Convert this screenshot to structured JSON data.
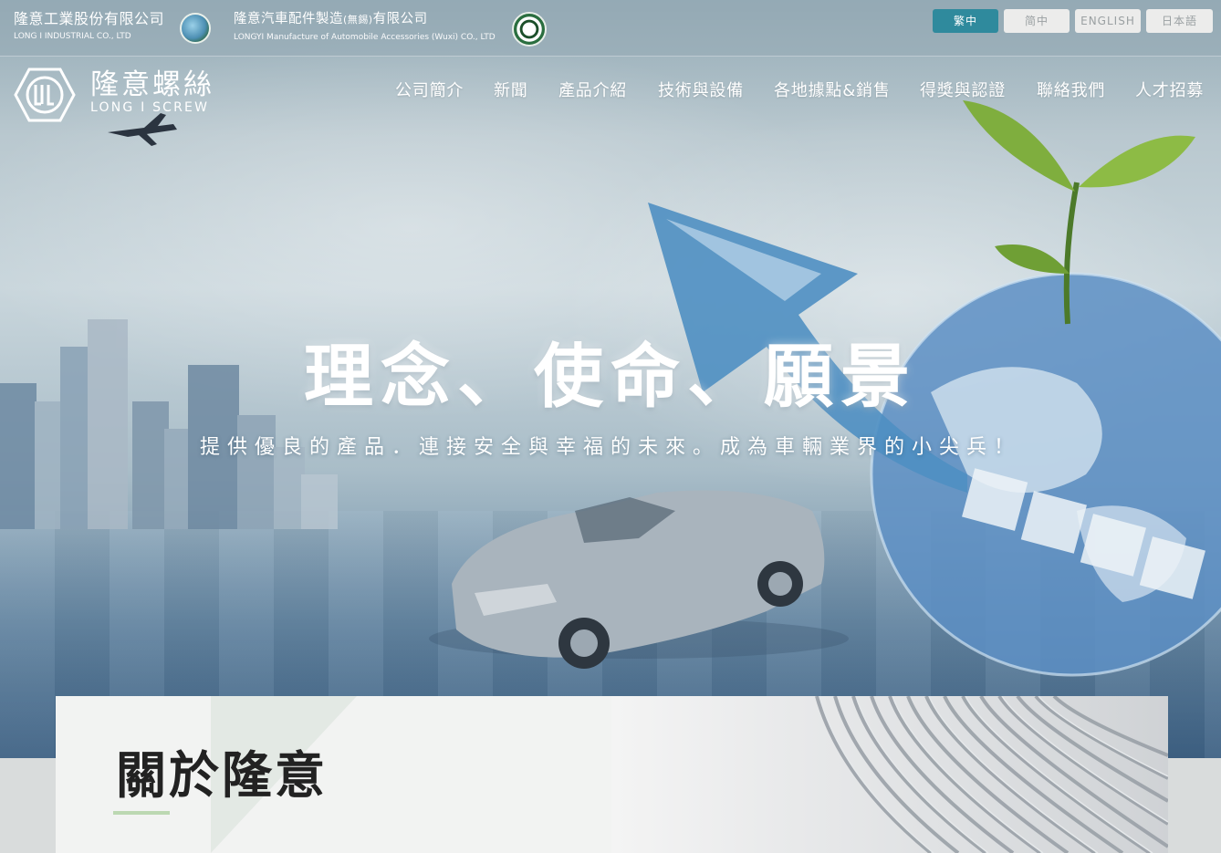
{
  "top_bar": {
    "company_1": {
      "name": "隆意工業股份有限公司",
      "sub": "LONG I INDUSTRIAL CO., LTD"
    },
    "company_2": {
      "name_main": "隆意汽車配件製造",
      "name_paren": "(無錫)",
      "name_tail": "有限公司",
      "sub": "LONGYI Manufacture of Automobile Accessories (Wuxi) CO., LTD"
    },
    "languages": [
      {
        "label": "繁中",
        "active": true
      },
      {
        "label": "简中",
        "active": false
      },
      {
        "label": "ENGLISH",
        "active": false
      },
      {
        "label": "日本語",
        "active": false
      }
    ]
  },
  "brand": {
    "name": "隆意螺絲",
    "name_en": "LONG I SCREW"
  },
  "nav": {
    "items": [
      "公司簡介",
      "新聞",
      "產品介紹",
      "技術與設備",
      "各地據點&銷售",
      "得獎與認證",
      "聯絡我們",
      "人才招募"
    ]
  },
  "hero": {
    "title": "理念、使命、願景",
    "slogan": "提供優良的產品．連接安全與幸福的未來。成為車輛業界的小尖兵！"
  },
  "about": {
    "title": "關於隆意"
  },
  "colors": {
    "accent": "#2f8a9d",
    "underline": "#bcd8b2"
  }
}
